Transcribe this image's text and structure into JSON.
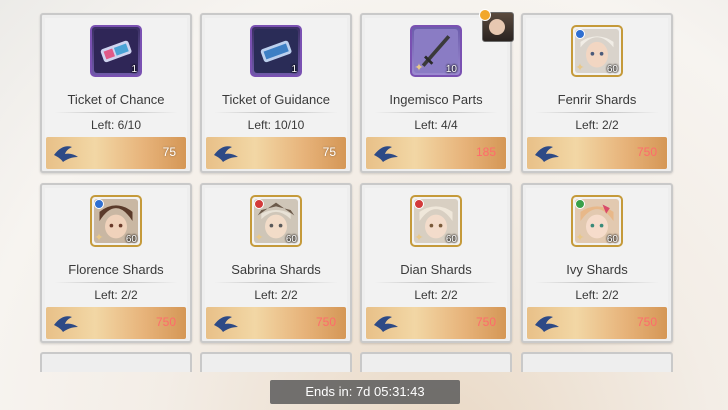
{
  "cards": [
    {
      "name": "Ticket of Chance",
      "left": "Left: 6/10",
      "price": "75",
      "qty": "1",
      "priceColor": "white",
      "kind": "ticket"
    },
    {
      "name": "Ticket of Guidance",
      "left": "Left: 10/10",
      "price": "75",
      "qty": "1",
      "priceColor": "white",
      "kind": "ticket"
    },
    {
      "name": "Ingemisco Parts",
      "left": "Left: 4/4",
      "price": "185",
      "qty": "10",
      "priceColor": "pink",
      "kind": "weapon"
    },
    {
      "name": "Fenrir Shards",
      "left": "Left: 2/2",
      "price": "750",
      "qty": "60",
      "priceColor": "pink",
      "kind": "char"
    },
    {
      "name": "Florence Shards",
      "left": "Left: 2/2",
      "price": "750",
      "qty": "60",
      "priceColor": "pink",
      "kind": "char"
    },
    {
      "name": "Sabrina Shards",
      "left": "Left: 2/2",
      "price": "750",
      "qty": "60",
      "priceColor": "pink",
      "kind": "char"
    },
    {
      "name": "Dian Shards",
      "left": "Left: 2/2",
      "price": "750",
      "qty": "60",
      "priceColor": "pink",
      "kind": "char"
    },
    {
      "name": "Ivy Shards",
      "left": "Left: 2/2",
      "price": "750",
      "qty": "60",
      "priceColor": "pink",
      "kind": "char"
    }
  ],
  "timer": "Ends in: 7d 05:31:43",
  "colors": {
    "price_pink": "#ff6b6b",
    "rarity_purple": "#7a51b2",
    "rarity_gold": "#c59a3a"
  }
}
